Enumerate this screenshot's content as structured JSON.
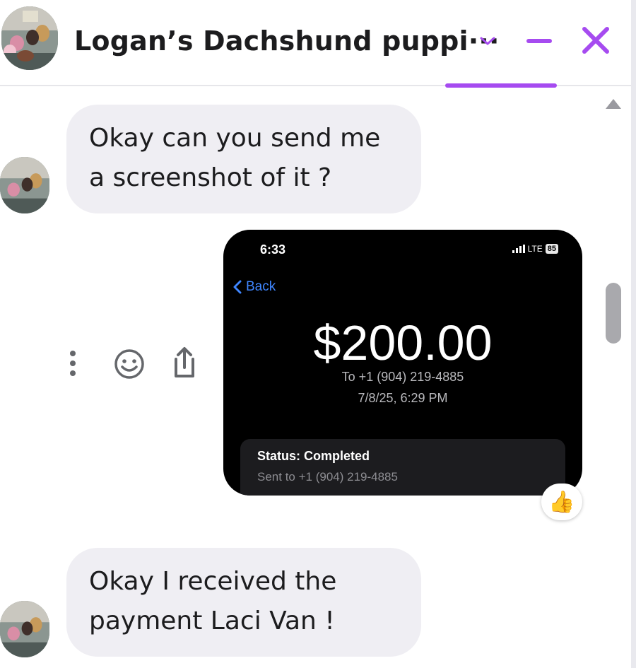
{
  "header": {
    "title": "Logan’s Dachshund puppi···",
    "accent_color": "#a64bf0"
  },
  "messages": [
    {
      "lines": [
        "Okay can you send me",
        "a screenshot of it ?"
      ]
    },
    {
      "lines": [
        "Okay I received the",
        "payment Laci Van !"
      ]
    }
  ],
  "attachment": {
    "time": "6:33",
    "network": "LTE",
    "battery": "85",
    "back_label": "Back",
    "amount": "$200.00",
    "to": "To +1 (904) 219-4885",
    "date": "7/8/25, 6:29 PM",
    "status_title": "Status: Completed",
    "status_sub": "Sent to +1 (904) 219-4885"
  },
  "reaction": {
    "emoji": "👍"
  },
  "icons": {
    "more": "more-vertical-icon",
    "react": "smiley-icon",
    "share": "share-icon",
    "collapse": "chevron-down-icon",
    "minimize": "minimize-icon",
    "close": "close-icon"
  }
}
